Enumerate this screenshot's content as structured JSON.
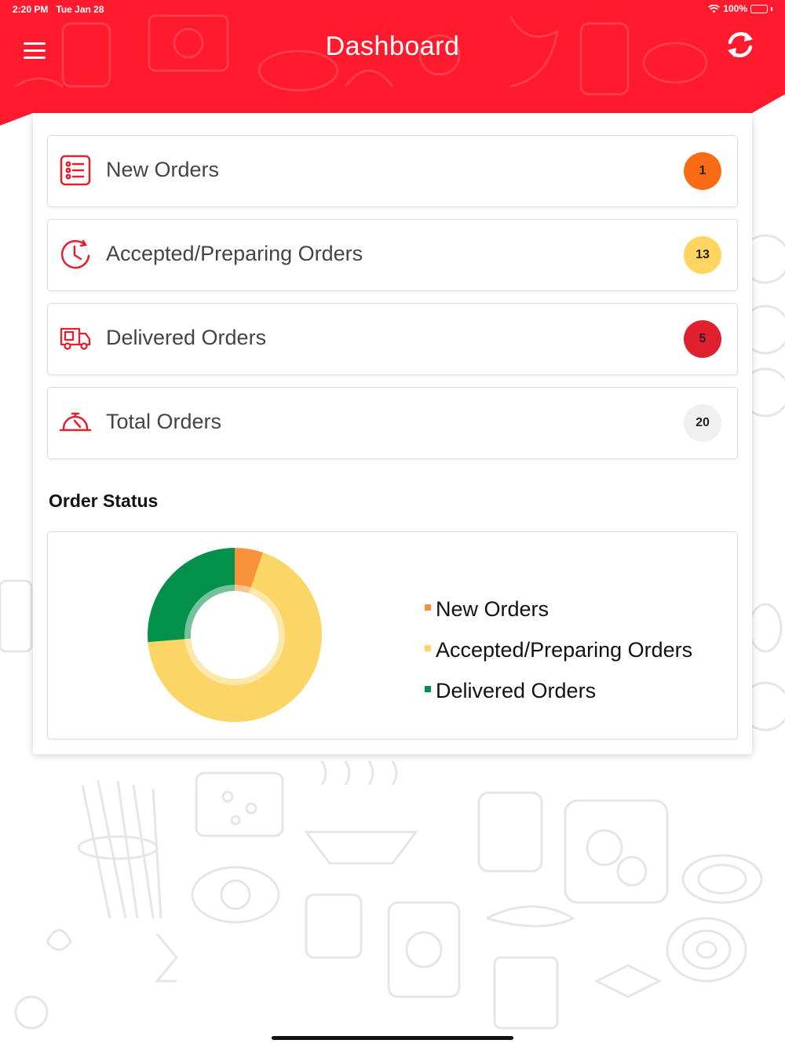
{
  "status_bar": {
    "time": "2:20 PM",
    "date": "Tue Jan 28",
    "battery": "100%",
    "wifi_icon": "wifi-icon",
    "battery_icon": "battery-icon"
  },
  "header": {
    "title": "Dashboard",
    "menu_icon": "hamburger-menu-icon",
    "refresh_icon": "refresh-icon",
    "color": "#ff1a2e"
  },
  "orders": [
    {
      "label": "New Orders",
      "count": "1",
      "icon": "order-list-icon",
      "badge_color": "#fb6b16"
    },
    {
      "label": "Accepted/Preparing Orders",
      "count": "13",
      "icon": "clock-icon",
      "badge_color": "#fdd560"
    },
    {
      "label": "Delivered Orders",
      "count": "5",
      "icon": "delivery-truck-icon",
      "badge_color": "#e0202e"
    },
    {
      "label": "Total Orders",
      "count": "20",
      "icon": "food-cloche-icon",
      "badge_color": "#f0f0f0"
    }
  ],
  "order_status": {
    "title": "Order Status"
  },
  "chart_data": {
    "type": "pie",
    "donut": true,
    "categories": [
      "New Orders",
      "Accepted/Preparing Orders",
      "Delivered Orders"
    ],
    "values": [
      1,
      13,
      5
    ],
    "colors": [
      "#f7923a",
      "#fbd666",
      "#02904a"
    ],
    "legend_position": "right"
  }
}
